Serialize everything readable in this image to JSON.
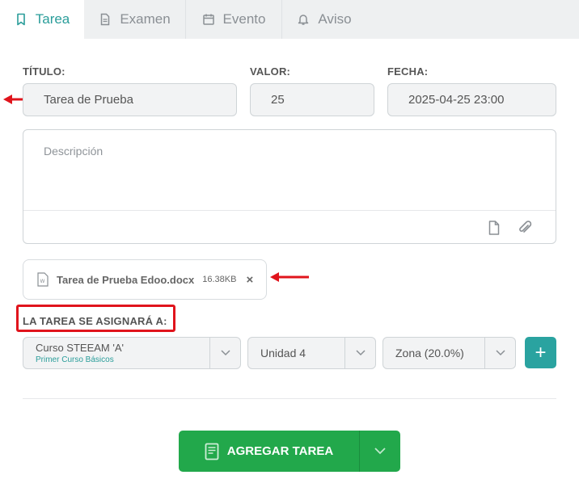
{
  "tabs": [
    {
      "label": "Tarea",
      "icon": "bookmark-icon",
      "active": true
    },
    {
      "label": "Examen",
      "icon": "document-icon",
      "active": false
    },
    {
      "label": "Evento",
      "icon": "calendar-icon",
      "active": false
    },
    {
      "label": "Aviso",
      "icon": "bell-icon",
      "active": false
    }
  ],
  "form": {
    "title_label": "TÍTULO:",
    "title_value": "Tarea de Prueba",
    "value_label": "VALOR:",
    "value_value": "25",
    "date_label": "FECHA:",
    "date_value": "2025-04-25 23:00",
    "description_placeholder": "Descripción"
  },
  "attachment": {
    "name": "Tarea de Prueba Edoo.docx",
    "size": "16.38KB",
    "close": "×"
  },
  "assign": {
    "label": "LA TAREA SE ASIGNARÁ A:",
    "course": "Curso STEEAM 'A'",
    "course_sub": "Primer Curso Básicos",
    "unit": "Unidad 4",
    "zone": "Zona (20.0%)",
    "add": "+"
  },
  "submit": {
    "label": "AGREGAR TAREA"
  },
  "colors": {
    "accent": "#2a9d9a",
    "submit": "#22a84b",
    "highlight": "#e0141c"
  }
}
